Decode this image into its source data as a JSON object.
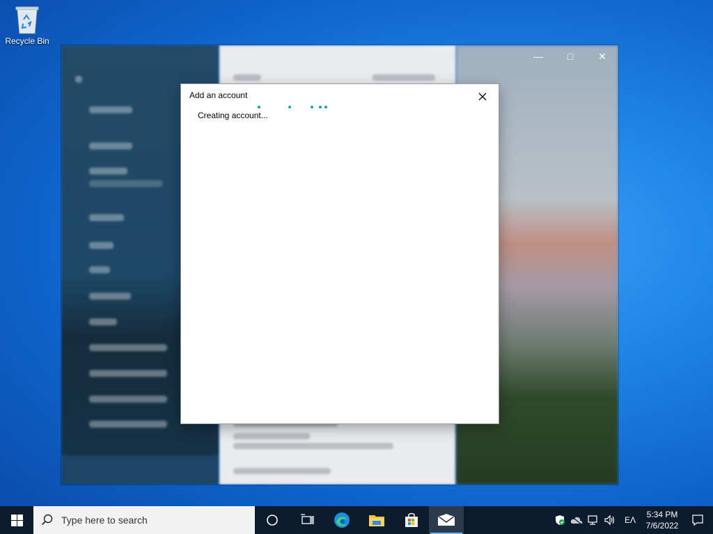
{
  "desktop": {
    "recycle_bin_label": "Recycle Bin"
  },
  "dialog": {
    "title": "Add an account",
    "status_text": "Creating account..."
  },
  "taskbar": {
    "search_placeholder": "Type here to search",
    "tray_language": "ΕΛ",
    "clock_time": "5:34 PM",
    "clock_date": "7/6/2022"
  },
  "colors": {
    "progress_dot": "#16a39a",
    "taskbar": "#0d1b2e",
    "active_indicator": "#76b9ed"
  },
  "icons": [
    "recycle-bin-icon",
    "close-icon",
    "windows-start-icon",
    "search-icon",
    "cortana-icon",
    "task-view-icon",
    "edge-icon",
    "file-explorer-icon",
    "store-icon",
    "mail-icon",
    "security-icon",
    "network-icon",
    "volume-icon",
    "notification-icon"
  ]
}
